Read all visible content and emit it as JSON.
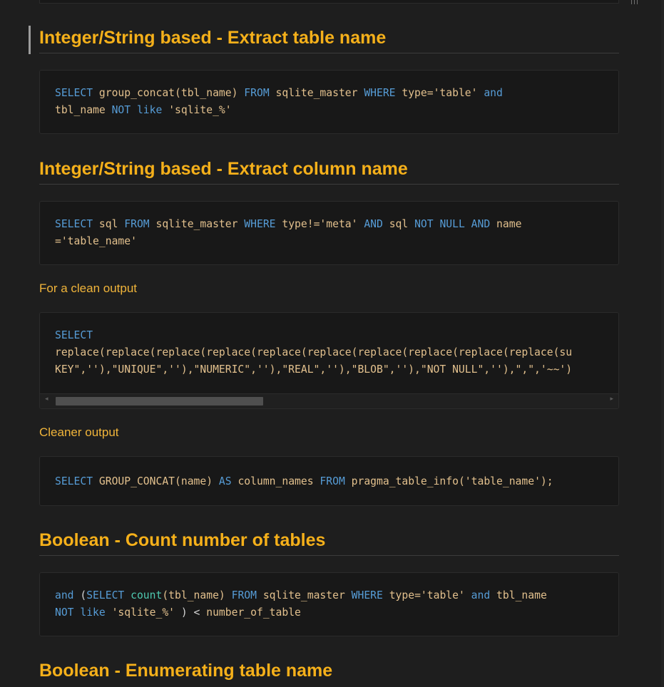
{
  "sections": [
    {
      "heading": "Integer/String based - Extract table name",
      "code_lines": [
        [
          {
            "t": "kw",
            "v": "SELECT "
          },
          {
            "t": "plain",
            "v": "group_concat(tbl_name) "
          },
          {
            "t": "kw",
            "v": "FROM "
          },
          {
            "t": "plain",
            "v": "sqlite_master "
          },
          {
            "t": "kw",
            "v": "WHERE "
          },
          {
            "t": "plain",
            "v": "type="
          },
          {
            "t": "plain",
            "v": "'table' "
          },
          {
            "t": "kw",
            "v": "and"
          }
        ],
        [
          {
            "t": "plain",
            "v": "tbl_name "
          },
          {
            "t": "kw",
            "v": "NOT like "
          },
          {
            "t": "plain",
            "v": "'sqlite_%'"
          }
        ]
      ]
    },
    {
      "heading": "Integer/String based - Extract column name",
      "code_lines": [
        [
          {
            "t": "kw",
            "v": "SELECT "
          },
          {
            "t": "plain",
            "v": "sql "
          },
          {
            "t": "kw",
            "v": "FROM "
          },
          {
            "t": "plain",
            "v": "sqlite_master "
          },
          {
            "t": "kw",
            "v": "WHERE "
          },
          {
            "t": "plain",
            "v": "type!='meta' "
          },
          {
            "t": "kw",
            "v": "AND "
          },
          {
            "t": "plain",
            "v": "sql "
          },
          {
            "t": "kw",
            "v": "NOT NULL AND "
          },
          {
            "t": "plain",
            "v": "name"
          }
        ],
        [
          {
            "t": "plain",
            "v": "='table_name'"
          }
        ]
      ]
    }
  ],
  "clean_output": {
    "label": "For a clean output",
    "code_lines": [
      [
        {
          "t": "kw",
          "v": "SELECT"
        }
      ],
      [
        {
          "t": "plain",
          "v": "replace(replace(replace(replace(replace(replace(replace(replace(replace(replace(su"
        }
      ],
      [
        {
          "t": "plain",
          "v": "KEY\",''),\"UNIQUE\",''),\"NUMERIC\",''),\"REAL\",''),\"BLOB\",''),\"NOT NULL\",''),\",\",'~~')"
        }
      ]
    ],
    "scroll_position": 0.36
  },
  "cleaner_output": {
    "label": "Cleaner output",
    "code_lines": [
      [
        {
          "t": "kw",
          "v": "SELECT "
        },
        {
          "t": "plain",
          "v": "GROUP_CONCAT(name) "
        },
        {
          "t": "kw",
          "v": "AS "
        },
        {
          "t": "plain",
          "v": "column_names "
        },
        {
          "t": "kw",
          "v": "FROM "
        },
        {
          "t": "plain",
          "v": "pragma_table_info('table_name');"
        }
      ]
    ]
  },
  "boolean_count": {
    "heading": "Boolean - Count number of tables",
    "code_lines": [
      [
        {
          "t": "kw",
          "v": "and "
        },
        {
          "t": "op",
          "v": "("
        },
        {
          "t": "kw",
          "v": "SELECT "
        },
        {
          "t": "fn",
          "v": "count"
        },
        {
          "t": "plain",
          "v": "(tbl_name) "
        },
        {
          "t": "kw",
          "v": "FROM "
        },
        {
          "t": "plain",
          "v": "sqlite_master "
        },
        {
          "t": "kw",
          "v": "WHERE "
        },
        {
          "t": "plain",
          "v": "type='table' "
        },
        {
          "t": "kw",
          "v": "and "
        },
        {
          "t": "plain",
          "v": "tbl_name"
        }
      ],
      [
        {
          "t": "kw",
          "v": "NOT like "
        },
        {
          "t": "plain",
          "v": "'sqlite_%' "
        },
        {
          "t": "op",
          "v": ") < "
        },
        {
          "t": "plain",
          "v": "number_of_table"
        }
      ]
    ]
  },
  "boolean_enum": {
    "heading": "Boolean - Enumerating table name"
  },
  "colors": {
    "heading": "#f5b01a",
    "keyword": "#569cd6",
    "identifier": "#e2c08d",
    "function": "#4ec9b0",
    "background": "#1e1e1e",
    "code_background": "#181818"
  }
}
